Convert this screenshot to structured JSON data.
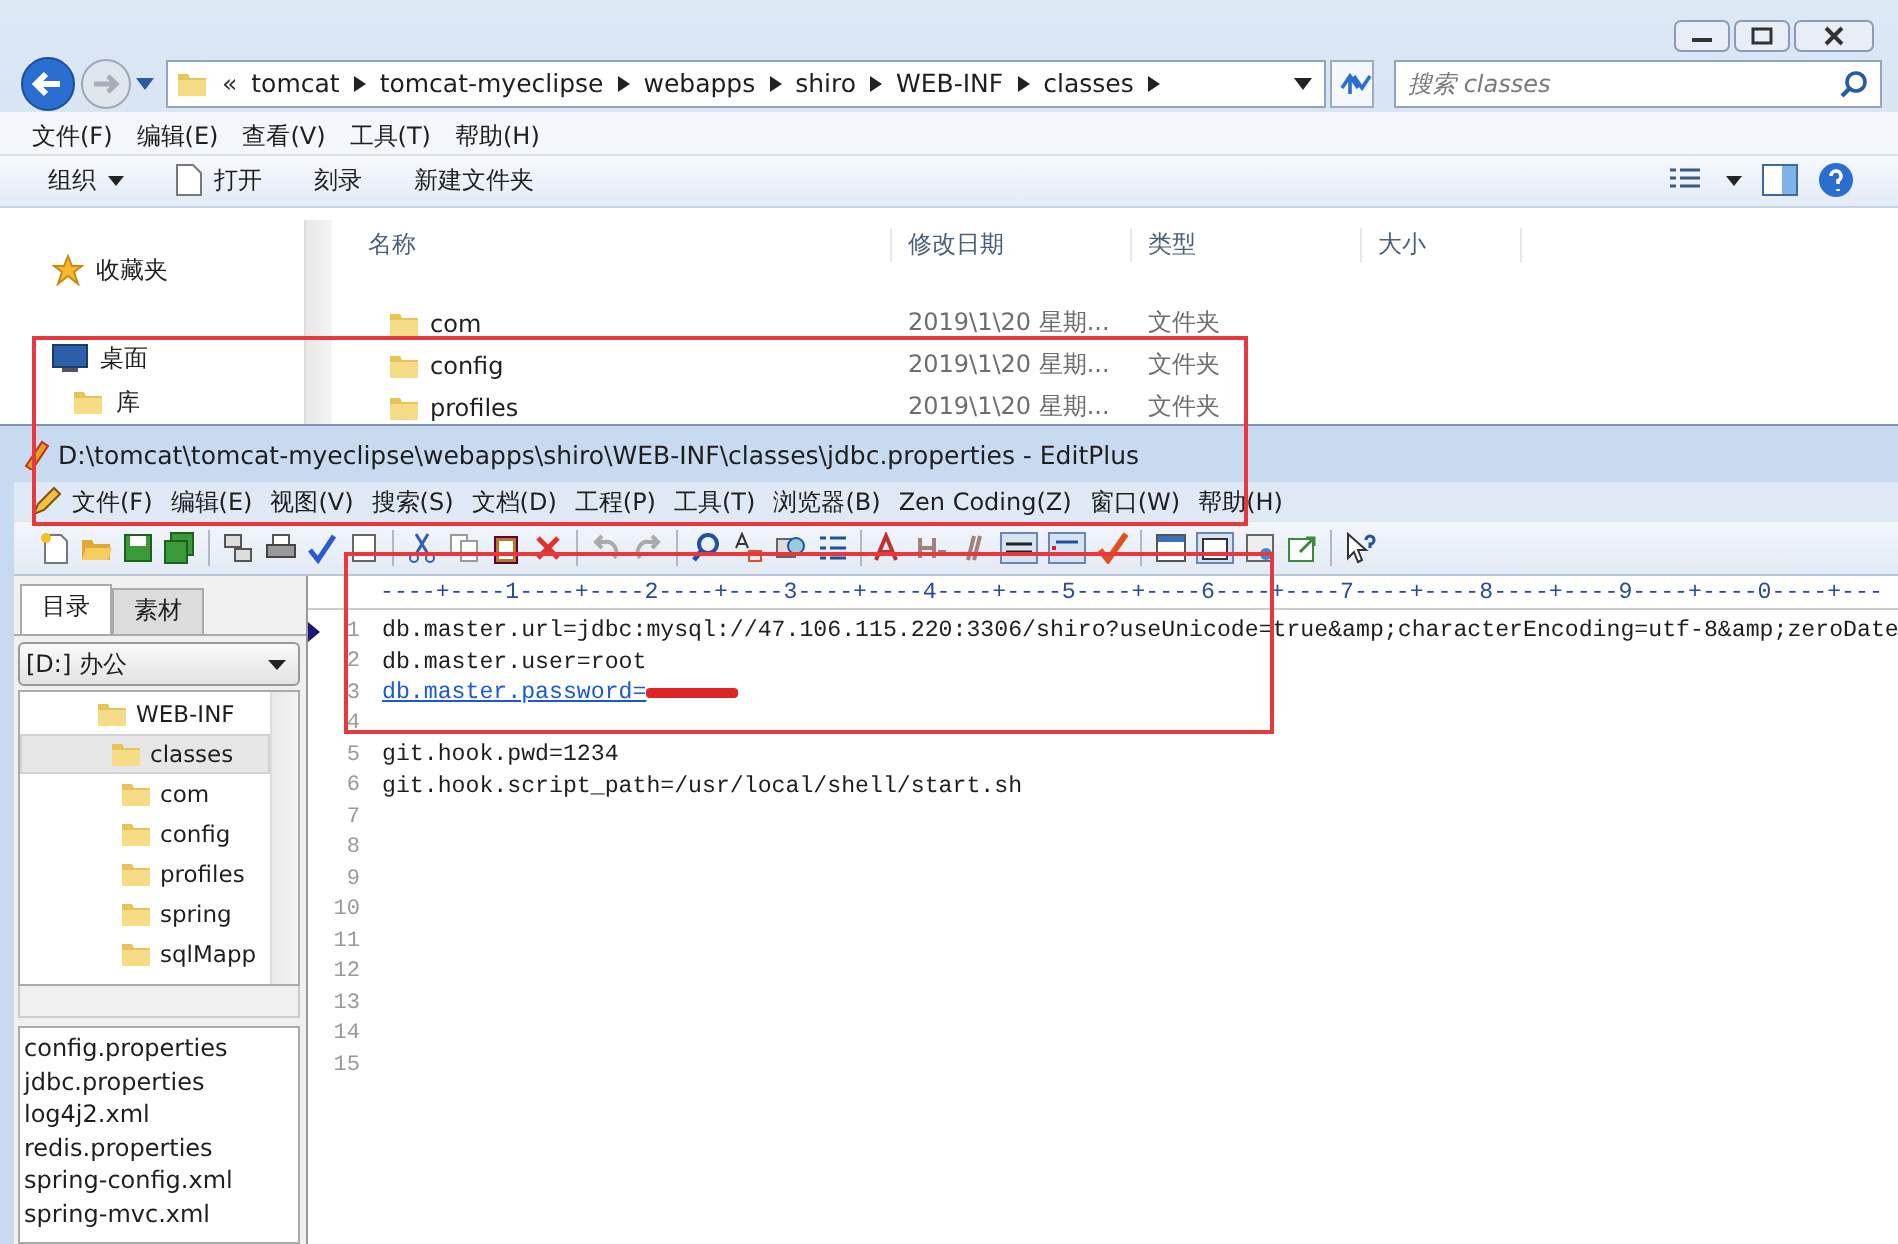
{
  "explorer": {
    "address_overflow": "«",
    "address": [
      "tomcat",
      "tomcat-myeclipse",
      "webapps",
      "shiro",
      "WEB-INF",
      "classes"
    ],
    "search": {
      "placeholder": "搜索 classes"
    },
    "menu": [
      "文件(F)",
      "编辑(E)",
      "查看(V)",
      "工具(T)",
      "帮助(H)"
    ],
    "toolbar": [
      {
        "label": "组织",
        "kind": "dropdown"
      },
      {
        "label": "打开",
        "kind": "open"
      },
      {
        "label": "刻录",
        "kind": "plain"
      },
      {
        "label": "新建文件夹",
        "kind": "plain"
      }
    ],
    "navigation": [
      {
        "label": "收藏夹",
        "kind": "favorites"
      },
      {
        "label": "桌面",
        "kind": "desktop"
      },
      {
        "label": "库",
        "kind": "library"
      }
    ],
    "columns": [
      "名称",
      "修改日期",
      "类型",
      "大小"
    ],
    "rows": [
      {
        "name": "com",
        "modified": "2019\\1\\20 星期...",
        "type": "文件夹"
      },
      {
        "name": "config",
        "modified": "2019\\1\\20 星期...",
        "type": "文件夹"
      },
      {
        "name": "profiles",
        "modified": "2019\\1\\20 星期...",
        "type": "文件夹"
      }
    ]
  },
  "editplus": {
    "title": "D:\\tomcat\\tomcat-myeclipse\\webapps\\shiro\\WEB-INF\\classes\\jdbc.properties - EditPlus",
    "menu": [
      "文件(F)",
      "编辑(E)",
      "视图(V)",
      "搜索(S)",
      "文档(D)",
      "工程(P)",
      "工具(T)",
      "浏览器(B)",
      "Zen Coding(Z)",
      "窗口(W)",
      "帮助(H)"
    ],
    "tabs": [
      {
        "label": "目录",
        "selected": true
      },
      {
        "label": "素材",
        "selected": false
      }
    ],
    "drive": "[D:] 办公",
    "tree": [
      {
        "label": "WEB-INF",
        "selected": false,
        "children": [
          {
            "label": "classes",
            "selected": true,
            "children": [
              {
                "label": "com",
                "selected": false
              },
              {
                "label": "config",
                "selected": false
              },
              {
                "label": "profiles",
                "selected": false
              },
              {
                "label": "spring",
                "selected": false
              },
              {
                "label": "sqlMapp",
                "selected": false
              }
            ]
          }
        ]
      }
    ],
    "files": [
      "config.properties",
      "jdbc.properties",
      "log4j2.xml",
      "redis.properties",
      "spring-config.xml",
      "spring-mvc.xml"
    ],
    "ruler": "----+----1----+----2----+----3----+----4----+----5----+----6----+----7----+----8----+----9----+----0----+---",
    "lines": [
      {
        "number": "1",
        "text": "db.master.url=jdbc:mysql://47.106.115.220:3306/shiro?useUnicode=true&amp;characterEncoding=utf-8&amp;zeroDate",
        "kind": "plain",
        "current": true,
        "redacted": false
      },
      {
        "number": "2",
        "text": "db.master.user=root",
        "kind": "plain",
        "current": false,
        "redacted": false
      },
      {
        "number": "3",
        "text": "db.master.password=",
        "kind": "link",
        "current": false,
        "redacted": true
      },
      {
        "number": "4",
        "current": false,
        "redacted": false
      },
      {
        "number": "5",
        "text": "git.hook.pwd=1234",
        "kind": "plain",
        "current": false,
        "redacted": false
      },
      {
        "number": "6",
        "text": "git.hook.script_path=/usr/local/shell/start.sh",
        "kind": "plain",
        "current": false,
        "redacted": false
      },
      {
        "number": "7",
        "current": false,
        "redacted": false
      },
      {
        "number": "8",
        "current": false,
        "redacted": false
      },
      {
        "number": "9",
        "current": false,
        "redacted": false
      },
      {
        "number": "10",
        "current": false,
        "redacted": false
      },
      {
        "number": "11",
        "current": false,
        "redacted": false
      },
      {
        "number": "12",
        "current": false,
        "redacted": false
      },
      {
        "number": "13",
        "current": false,
        "redacted": false
      },
      {
        "number": "14",
        "current": false,
        "redacted": false
      },
      {
        "number": "15",
        "current": false,
        "redacted": false
      }
    ]
  }
}
